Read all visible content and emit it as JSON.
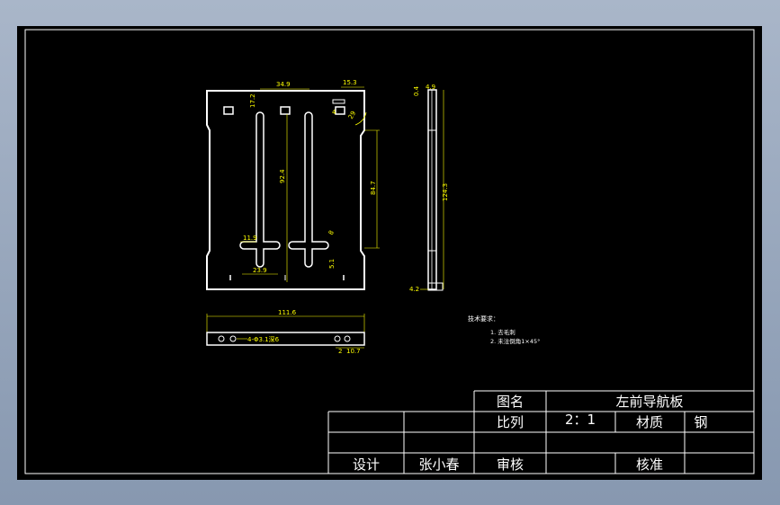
{
  "drawing": {
    "dimensions": {
      "top_width": "34.9",
      "top_right": "15.3",
      "left_small": "17.2",
      "slot_length": "92.4",
      "right_height": "84.7",
      "small_right_a": "4",
      "small_right_b": "29",
      "bottom_slot": "11.9",
      "bottom_offset": "23.9",
      "r_small": "8",
      "h_small": "5.1",
      "side_top_a": "0.4",
      "side_top_b": "4.9",
      "side_height": "124.3",
      "side_bottom": "4.2",
      "bottom_width": "111.6",
      "holes_note": "4-Φ3.1深6",
      "bottom_right_a": "2",
      "bottom_right_b": "10.7"
    },
    "notes": {
      "title": "技术要求：",
      "line1": "1.  去毛刺",
      "line2": "2.  未注倒角1×45°"
    }
  },
  "title_block": {
    "drawing_name_label": "图名",
    "drawing_name": "左前导航板",
    "scale_label": "比列",
    "scale": "2：1",
    "material_label": "材质",
    "material": "钢",
    "designer_label": "设计",
    "designer": "张小春",
    "review_label": "审核",
    "approve_label": "核准"
  },
  "colors": {
    "background": "#000000",
    "lines": "#ffffff",
    "dimensions": "#ffff00"
  }
}
